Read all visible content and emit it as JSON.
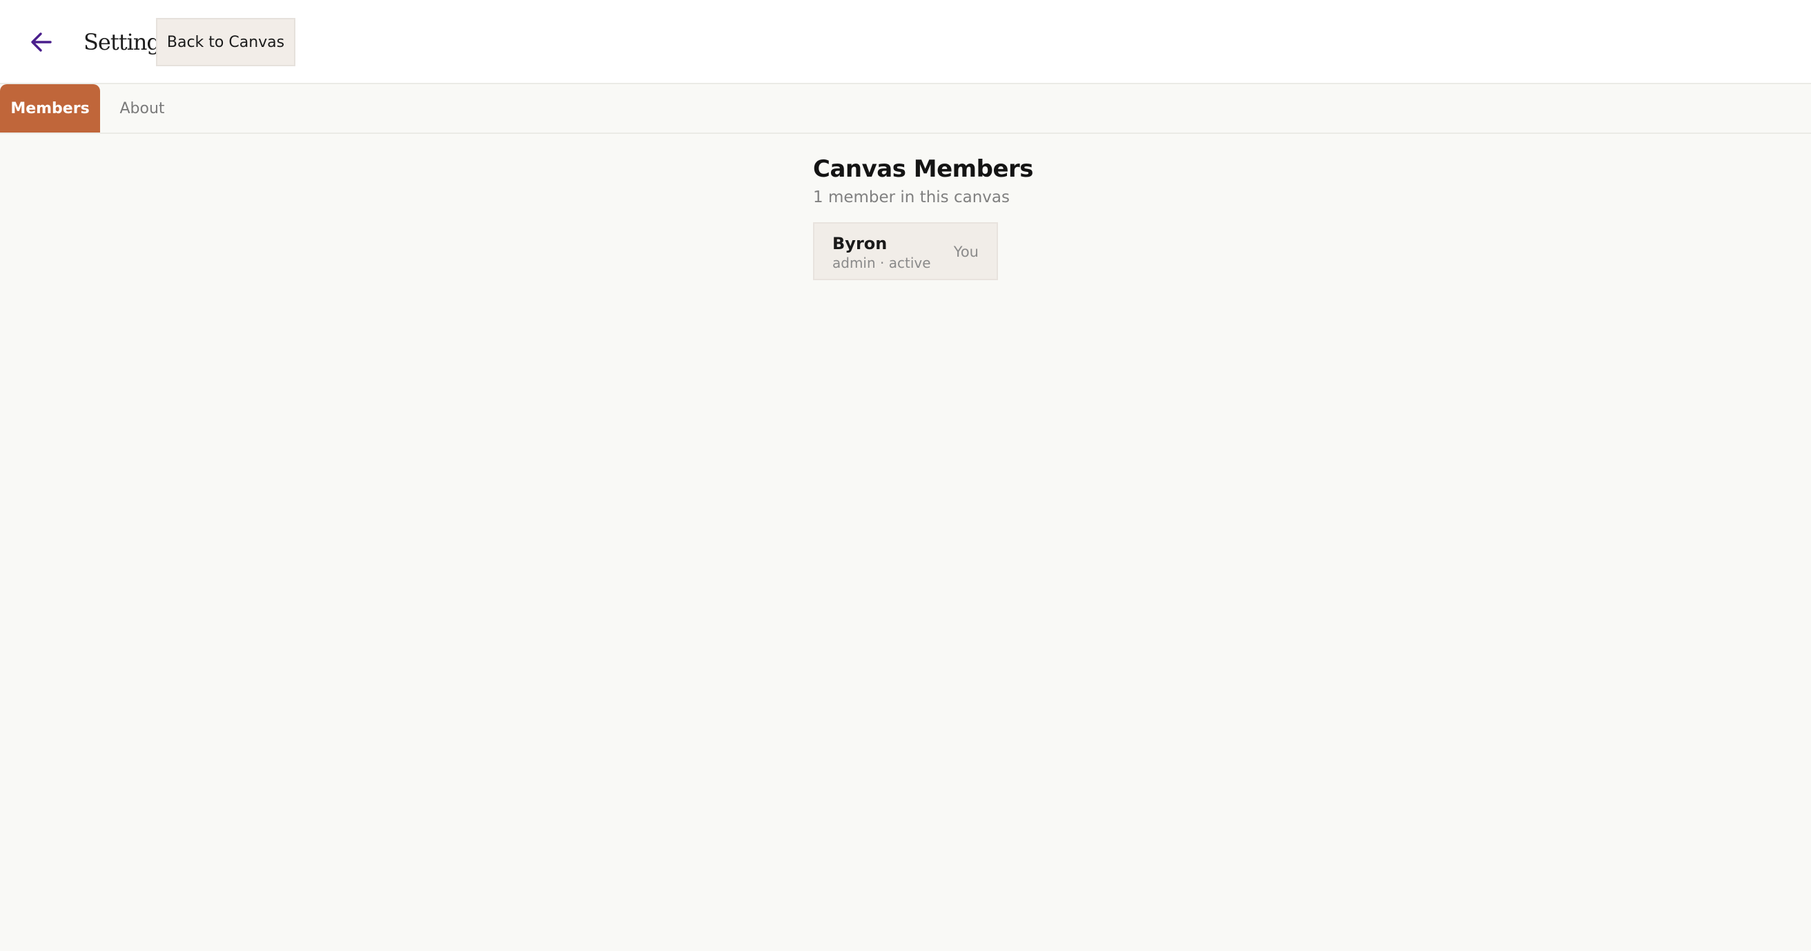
{
  "header": {
    "back_icon": "arrow-left-icon",
    "title": "Settings",
    "back_to_canvas_label": "Back to Canvas",
    "accent_color": "#4a1f8c"
  },
  "tabs": [
    {
      "label": "Members",
      "active": true
    },
    {
      "label": "About",
      "active": false
    }
  ],
  "members_section": {
    "title": "Canvas Members",
    "subtitle": "1 member in this canvas",
    "members": [
      {
        "name": "Byron",
        "meta": "admin · active",
        "badge": "You"
      }
    ]
  },
  "colors": {
    "active_tab": "#c0663a",
    "card_bg": "#f1ede8",
    "page_bg": "#f9f9f6"
  }
}
